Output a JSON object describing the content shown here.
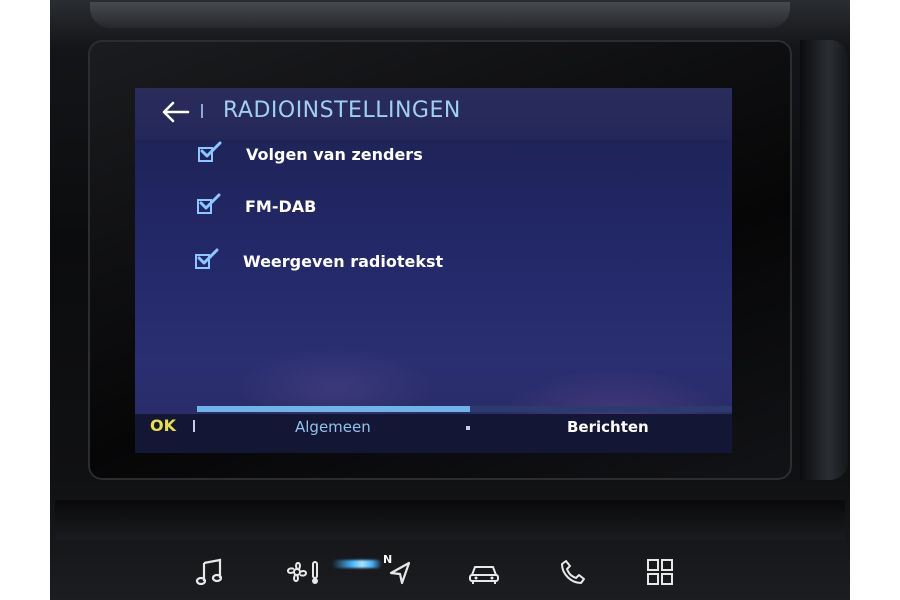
{
  "screen": {
    "title": "RADIOINSTELLINGEN",
    "back_icon": "arrow-left-icon",
    "options": [
      {
        "label": "Volgen van zenders",
        "checked": true
      },
      {
        "label": "FM-DAB",
        "checked": true
      },
      {
        "label": "Weergeven radiotekst",
        "checked": true
      }
    ],
    "tab_progress": 0.51,
    "bottom": {
      "ok_label": "OK",
      "tab_general": "Algemeen",
      "tab_messages": "Berichten"
    }
  },
  "hardware_buttons": [
    {
      "icon": "music-note-icon"
    },
    {
      "icon": "climate-fan-icon"
    },
    {
      "icon": "navigation-icon",
      "label": "N"
    },
    {
      "icon": "car-icon"
    },
    {
      "icon": "phone-icon"
    },
    {
      "icon": "apps-grid-icon"
    }
  ],
  "colors": {
    "accent_title": "#9fd0f0",
    "ok_yellow": "#e7e142",
    "checkbox_blue": "#8cc8ff",
    "screen_bg": "#232869"
  }
}
